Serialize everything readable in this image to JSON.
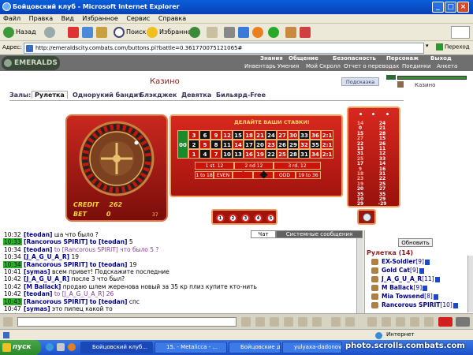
{
  "window": {
    "title": "Бойцовский клуб - Microsoft Internet Explorer"
  },
  "menu": {
    "items": [
      "Файл",
      "Правка",
      "Вид",
      "Избранное",
      "Сервис",
      "Справка"
    ]
  },
  "toolbar": {
    "back": "Назад",
    "search": "Поиск",
    "favorites": "Избранное"
  },
  "address": {
    "label": "Адрес:",
    "url": "http://emeraldscity.combats.com/buttons.pl?battle=0.361770075121065#",
    "go": "Переход"
  },
  "site": {
    "logo": "EMERALDS",
    "nav_top": [
      "Знания",
      "Общение",
      "Безопасность",
      "Персонаж",
      "Выход"
    ],
    "nav_bottom": [
      "Инвентарь",
      "Умения",
      "Мой Скролл",
      "Отчет о переводах",
      "Поединки",
      "Анкета"
    ],
    "casino_title": "Казино",
    "hint": "Подсказка",
    "user_panel_label": "Казино"
  },
  "halls": {
    "label": "Залы:",
    "tabs": [
      "Рулетка",
      "Однорукий бандит",
      "Блэкджек",
      "Девятка",
      "Бильярд-Free"
    ]
  },
  "roulette": {
    "place_bets": "ДЕЛАЙТЕ ВАШИ СТАВКИ!",
    "zero": "00",
    "zero2": "0",
    "rows": [
      [
        "3",
        "6",
        "9",
        "12",
        "15",
        "18",
        "21",
        "24",
        "27",
        "30",
        "33",
        "36",
        "2:1"
      ],
      [
        "2",
        "5",
        "8",
        "11",
        "14",
        "17",
        "20",
        "23",
        "26",
        "29",
        "32",
        "35",
        "2:1"
      ],
      [
        "1",
        "4",
        "7",
        "10",
        "13",
        "16",
        "19",
        "22",
        "25",
        "28",
        "31",
        "34",
        "2:1"
      ]
    ],
    "dozens": [
      "1 st. 12",
      "2 nd 12",
      "3 rd. 12"
    ],
    "outside": [
      "1 to 18",
      "EVEN",
      "ODD",
      "19 to 36"
    ],
    "credit_label": "CREDIT",
    "credit_value": "262",
    "bet_label": "BET",
    "bet_value": "0",
    "wheel_number": "37",
    "chips": [
      "1",
      "2",
      "3",
      "4",
      "5"
    ],
    "history": [
      "14",
      "0",
      "15",
      "27",
      "22",
      "13",
      "31",
      "25",
      "17",
      "9",
      "18",
      "23",
      "19",
      "20",
      "35",
      "10",
      "29"
    ],
    "history2": [
      "24",
      "21",
      "28",
      "15",
      "26",
      "11",
      "12",
      "33",
      "14",
      "16",
      "31",
      "22",
      "25",
      "27",
      "35",
      "29",
      "-29"
    ]
  },
  "chat": {
    "tabs": [
      "Чат",
      "Системные сообщения"
    ],
    "messages": [
      {
        "time": "10:32",
        "hl": false,
        "who": "[teodan]",
        "text": "ша что было ?"
      },
      {
        "time": "10:33",
        "hl": true,
        "who": "[Rancorous SPIRIT]",
        "to": "to [teodan]",
        "text": "5"
      },
      {
        "time": "10:34",
        "hl": false,
        "who": "[teodan]",
        "to": "to [Rancorous SPIRIT]",
        "text": "что было 5 ?",
        "violet": true
      },
      {
        "time": "10:34",
        "hl": false,
        "who": "[J_A_G_U_A_R]",
        "text": "19"
      },
      {
        "time": "10:34",
        "hl": true,
        "who": "[Rancorous SPIRIT]",
        "to": "to [teodan]",
        "text": "19"
      },
      {
        "time": "10:41",
        "hl": false,
        "who": "[symas]",
        "text": "всем привет! Подскажите последние"
      },
      {
        "time": "10:42",
        "hl": false,
        "who": "[J_A_G_U_A_R]",
        "text": "после 3 что был?"
      },
      {
        "time": "10:42",
        "hl": false,
        "who": "[M Ballack]",
        "text": "продаю шлем жеренова новый за 35 кр плиз купите кто-нить"
      },
      {
        "time": "10:42",
        "hl": false,
        "who": "[teodan]",
        "to": "to [J_A_G_U_A_R]",
        "text": "26",
        "violet": true
      },
      {
        "time": "10:43",
        "hl": true,
        "who": "[Rancorous SPIRIT]",
        "to": "to [teodan]",
        "text": "спс"
      },
      {
        "time": "10:47",
        "hl": false,
        "who": "[symas]",
        "text": "это пипец какой то"
      }
    ]
  },
  "users": {
    "refresh": "Обновить",
    "room": "Рулетка (14)",
    "list": [
      {
        "name": "EX-Soldier",
        "lvl": "[9]"
      },
      {
        "name": "Gold Cat",
        "lvl": "[9]"
      },
      {
        "name": "J_A_G_U_A_R",
        "lvl": "[11]"
      },
      {
        "name": "M Ballack",
        "lvl": "[9]"
      },
      {
        "name": "Mia Towsend",
        "lvl": "[8]"
      },
      {
        "name": "Rancorous SPIRIT",
        "lvl": "[10]"
      }
    ]
  },
  "status": {
    "text": "Интернет"
  },
  "taskbar": {
    "start": "пуск",
    "tasks": [
      "Бойцовский клуб...",
      "15. - Metalicca - ...",
      "Бойцовские днев...",
      "yulyaxa-dadonov..."
    ],
    "watermark": "photo.scrolls.combats.com"
  }
}
